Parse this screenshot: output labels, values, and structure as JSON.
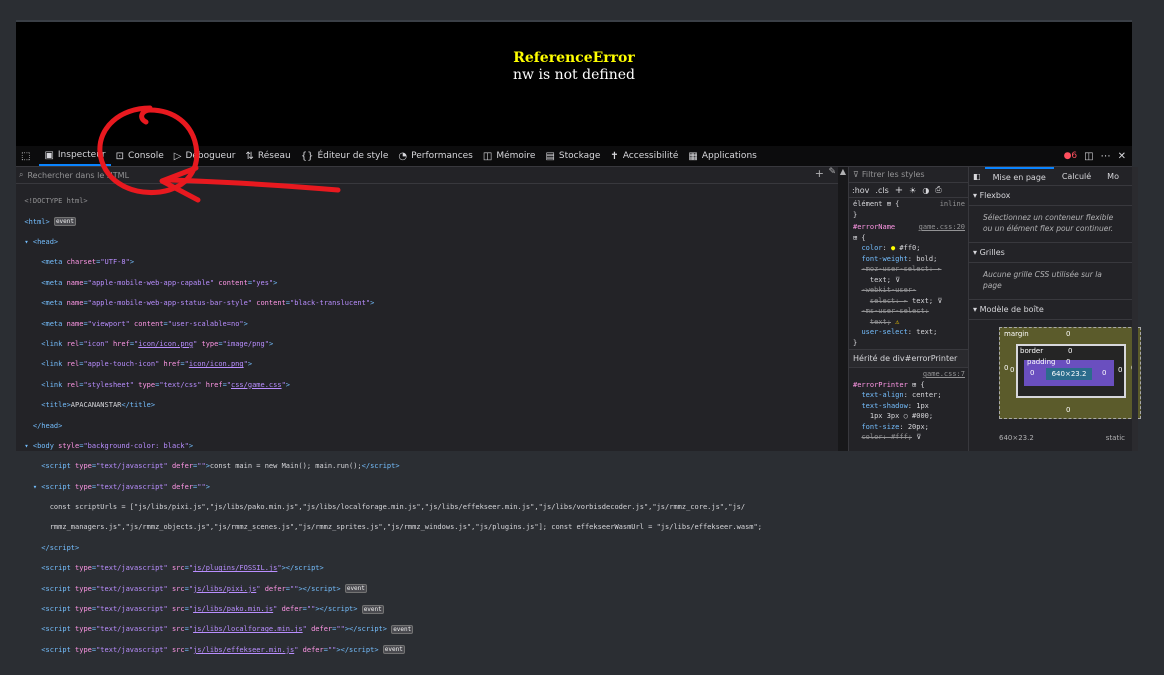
{
  "game": {
    "error_title": "ReferenceError",
    "error_message": "nw is not defined"
  },
  "toolbar": {
    "tabs": [
      {
        "label": "Inspecteur",
        "icon": "inspector-icon"
      },
      {
        "label": "Console",
        "icon": "console-icon"
      },
      {
        "label": "Débogueur",
        "icon": "debugger-icon"
      },
      {
        "label": "Réseau",
        "icon": "network-icon"
      },
      {
        "label": "Éditeur de style",
        "icon": "style-editor-icon"
      },
      {
        "label": "Performances",
        "icon": "performance-icon"
      },
      {
        "label": "Mémoire",
        "icon": "memory-icon"
      },
      {
        "label": "Stockage",
        "icon": "storage-icon"
      },
      {
        "label": "Accessibilité",
        "icon": "accessibility-icon"
      },
      {
        "label": "Applications",
        "icon": "applications-icon"
      }
    ],
    "error_count": "6"
  },
  "inspector": {
    "search_placeholder": "Rechercher dans le HTML"
  },
  "rules": {
    "filter_placeholder": "Filtrer les styles",
    "hov": ":hov",
    "cls": ".cls",
    "element_selector": "élément",
    "element_display": "inline",
    "source1": "game.css:20",
    "inherited_label": "Hérité de div#errorPrinter",
    "source2": "game.css:7"
  },
  "layout": {
    "tabs": [
      "Mise en page",
      "Calculé",
      "Mo"
    ],
    "flexbox_title": "Flexbox",
    "flexbox_hint": "Sélectionnez un conteneur flexible ou un élément flex pour continuer.",
    "grid_title": "Grilles",
    "grid_hint": "Aucune grille CSS utilisée sur la page",
    "boxmodel_title": "Modèle de boîte",
    "bm_margin": "margin",
    "bm_border": "border",
    "bm_padding": "padding",
    "bm_content": "640×23.2",
    "bm_zero": "0",
    "size": "640×23.2",
    "position": "static"
  },
  "colors": {
    "error_yellow": "#ffff00",
    "accent": "#0a84ff",
    "annotation_red": "#e8191f"
  }
}
